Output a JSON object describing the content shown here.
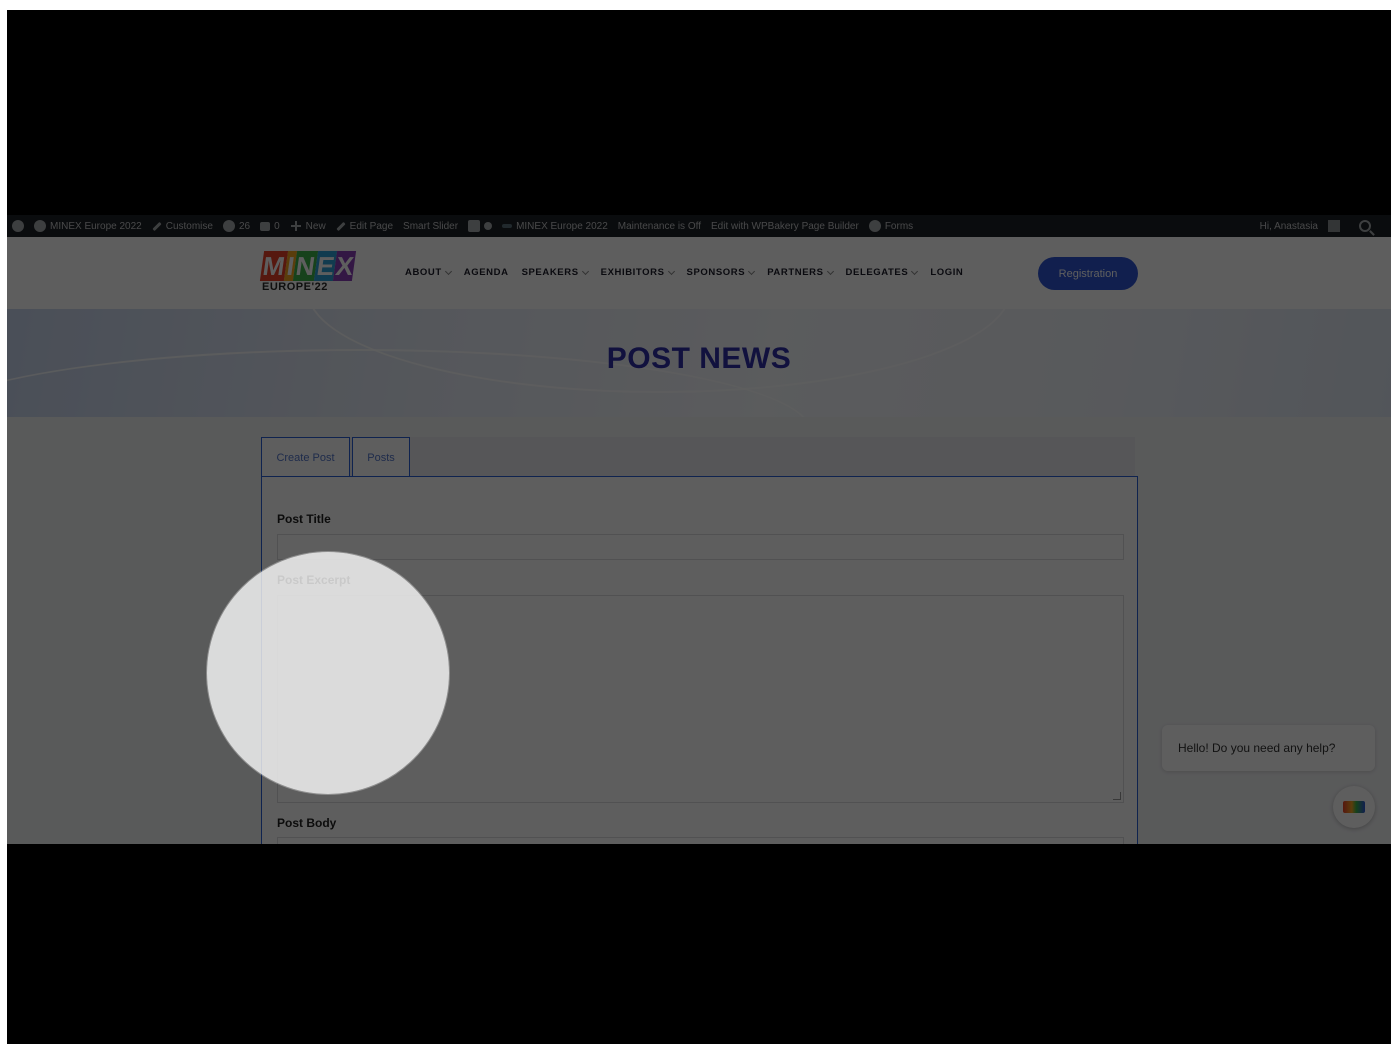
{
  "admin_bar": {
    "site_name": "MINEX Europe 2022",
    "customise": "Customise",
    "updates_count": "26",
    "comments_count": "0",
    "new_label": "New",
    "edit_page": "Edit Page",
    "smart_slider": "Smart Slider",
    "site_name_2": "MINEX Europe 2022",
    "maintenance": "Maintenance is Off",
    "wpbakery": "Edit with WPBakery Page Builder",
    "forms": "Forms",
    "greeting": "Hi, Anastasia"
  },
  "header": {
    "logo_letters": [
      "M",
      "I",
      "N",
      "E",
      "X"
    ],
    "logo_sub": "EUROPE'22",
    "nav": [
      {
        "label": "ABOUT",
        "dropdown": true
      },
      {
        "label": "AGENDA",
        "dropdown": false
      },
      {
        "label": "SPEAKERS",
        "dropdown": true
      },
      {
        "label": "EXHIBITORS",
        "dropdown": true
      },
      {
        "label": "SPONSORS",
        "dropdown": true
      },
      {
        "label": "PARTNERS",
        "dropdown": true
      },
      {
        "label": "DELEGATES",
        "dropdown": true
      },
      {
        "label": "LOGIN",
        "dropdown": false
      }
    ],
    "registration_label": "Registration"
  },
  "hero": {
    "title": "POST NEWS"
  },
  "form": {
    "tabs": [
      {
        "label": "Create Post",
        "active": true
      },
      {
        "label": "Posts",
        "active": false
      }
    ],
    "post_title_label": "Post Title",
    "post_title_value": "",
    "post_excerpt_label": "Post Excerpt",
    "post_excerpt_value": "",
    "post_body_label": "Post Body"
  },
  "chat": {
    "message": "Hello! Do you need any help?"
  },
  "colors": {
    "accent": "#2f55d4",
    "tab_border": "#2a5fd6",
    "title": "#2f2fa8",
    "admin_bar": "#1d2327",
    "logo": [
      "#e8412b",
      "#f5a623",
      "#3cb34a",
      "#2f9fd6",
      "#8b3fb8"
    ]
  }
}
